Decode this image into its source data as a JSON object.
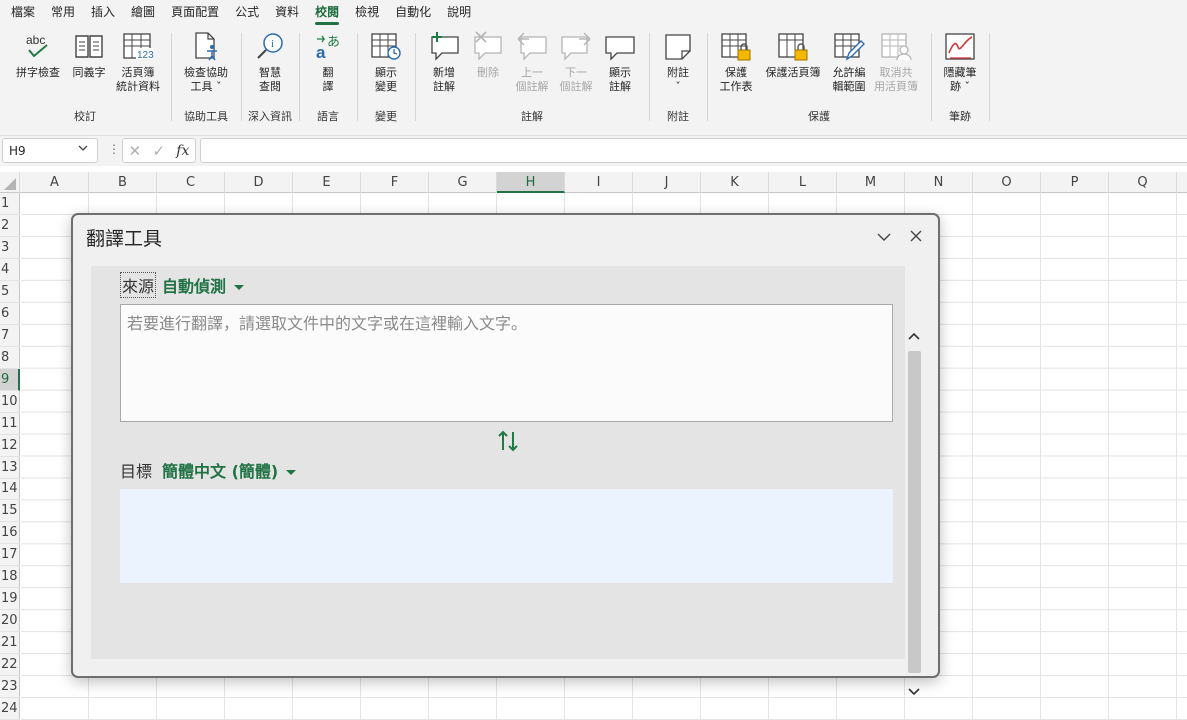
{
  "menu": {
    "tabs": [
      "檔案",
      "常用",
      "插入",
      "繪圖",
      "頁面配置",
      "公式",
      "資料",
      "校閱",
      "檢視",
      "自動化",
      "說明"
    ],
    "active": "校閱"
  },
  "ribbon": {
    "groups": {
      "proofing": "校訂",
      "accessibility": "協助工具",
      "insights": "深入資訊",
      "language": "語言",
      "changes": "變更",
      "comments": "註解",
      "notes": "附註",
      "protect": "保護",
      "ink": "筆跡"
    },
    "buttons": {
      "spelling": "拼字檢查",
      "thesaurus": "同義字",
      "workbook_stats": "活頁簿\n統計資料",
      "check_accessibility": "檢查協助\n工具 ˇ",
      "smart_lookup": "智慧\n查閱",
      "translate": "翻\n譯",
      "show_changes": "顯示\n變更",
      "new_comment": "新增\n註解",
      "delete_comment": "刪除",
      "prev_comment": "上一\n個註解",
      "next_comment": "下一\n個註解",
      "show_comments": "顯示\n註解",
      "notes": "附註\nˇ",
      "protect_sheet": "保護\n工作表",
      "protect_workbook": "保護活頁簿",
      "allow_edit_ranges": "允許編\n輯範圍",
      "unshare_workbook": "取消共\n用活頁簿",
      "hide_ink": "隱藏筆\n跡 ˇ"
    }
  },
  "formula_bar": {
    "name_box": "H9",
    "formula": ""
  },
  "grid": {
    "columns": [
      "A",
      "B",
      "C",
      "D",
      "E",
      "F",
      "G",
      "H",
      "I",
      "J",
      "K",
      "L",
      "M",
      "N",
      "O",
      "P",
      "Q"
    ],
    "rows": [
      "1",
      "2",
      "3",
      "4",
      "5",
      "6",
      "7",
      "8",
      "9",
      "10",
      "11",
      "12",
      "13",
      "14",
      "15",
      "16",
      "17",
      "18",
      "19",
      "20",
      "21",
      "22",
      "23",
      "24"
    ],
    "selected_col": "H",
    "selected_row": "9"
  },
  "translator": {
    "title": "翻譯工具",
    "source_label": "來源",
    "source_lang": "自動偵測",
    "source_placeholder": "若要進行翻譯，請選取文件中的文字或在這裡輸入文字。",
    "target_label": "目標",
    "target_lang": "簡體中文 (簡體)",
    "accent": "#217346"
  }
}
